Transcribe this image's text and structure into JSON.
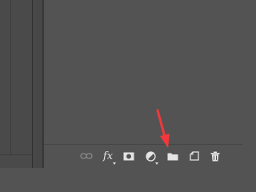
{
  "layers_panel": {
    "footer_buttons": [
      {
        "name": "link-layers-icon",
        "icon": "link"
      },
      {
        "name": "add-layer-style-button",
        "label": "fx"
      },
      {
        "name": "add-layer-mask-button",
        "icon": "mask"
      },
      {
        "name": "new-adjustment-layer-button",
        "icon": "half-circle"
      },
      {
        "name": "new-group-button",
        "icon": "folder"
      },
      {
        "name": "new-layer-button",
        "icon": "page"
      },
      {
        "name": "delete-layer-button",
        "icon": "trash"
      }
    ],
    "fx_label": "fx"
  },
  "annotation": {
    "arrow_color": "#f2383c",
    "target": "new-group-button"
  },
  "colors": {
    "panel_bg": "#535353",
    "icon": "#e4e4e4",
    "icon_disabled": "#8a8a8a"
  }
}
